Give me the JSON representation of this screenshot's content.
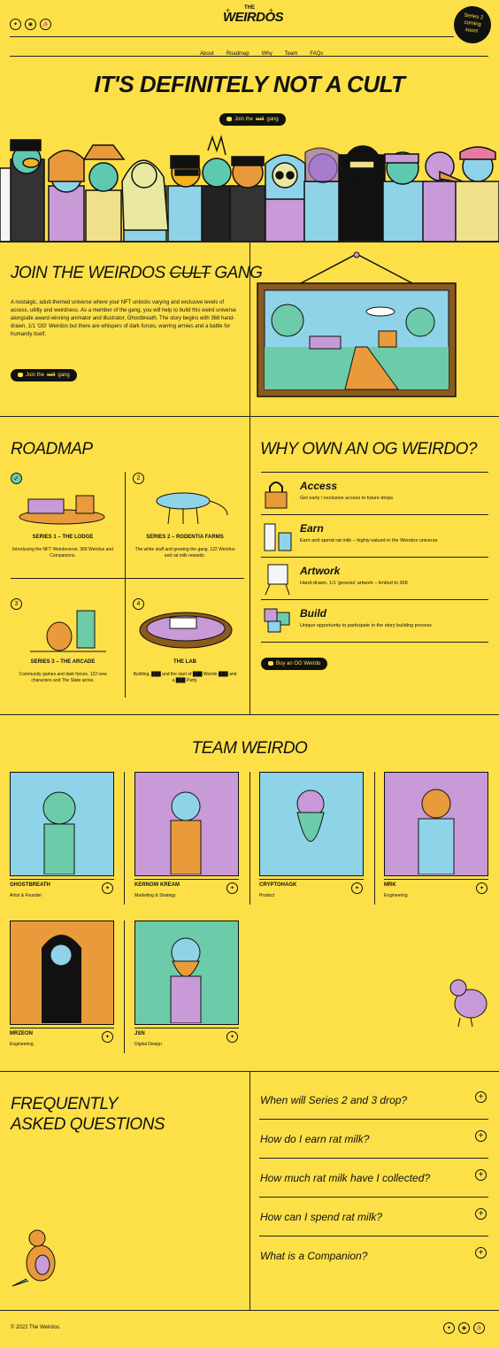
{
  "brand": {
    "logo_top": "THE",
    "logo_main": "WEIRDOS"
  },
  "badge": {
    "line1": "Series 2",
    "line2": "coming",
    "line3": "soon!"
  },
  "nav": [
    "About",
    "Roadmap",
    "Why",
    "Team",
    "FAQs"
  ],
  "hero": {
    "title": "IT'S DEFINITELY NOT A CULT",
    "cta_prefix": "Join the ",
    "cta_strike": "cult",
    "cta_suffix": " gang"
  },
  "about": {
    "title_prefix": "JOIN THE WEIRDOS ",
    "title_strike": "CULT",
    "title_suffix": " GANG",
    "body": "A nostalgic, adult-themed universe where your NFT unlocks varying and exclusive levels of access, utility and weirdness. As a member of the gang, you will help to build this weird universe alongside award-winning animator and illustrator, Ghostbreath. The story begins with 368 hand-drawn, 1/1 'OG' Weirdos but there are whispers of dark forces, warring armies and a battle for humanity itself.",
    "cta_prefix": "Join the ",
    "cta_strike": "cult",
    "cta_suffix": " gang"
  },
  "roadmap": {
    "title": "ROADMAP",
    "items": [
      {
        "num": "✓",
        "title": "SERIES 1 – THE LODGE",
        "desc": "Introducing the NFT Weirdoverse. 368 Weirdos and Companions."
      },
      {
        "num": "2",
        "title": "SERIES 2 – RODENTIA FARMS",
        "desc": "The white stuff and growing the gang. 122 Weirdos and rat milk rewards."
      },
      {
        "num": "3",
        "title": "SERIES 3 – THE ARCADE",
        "desc": "Community games and dark forces. 122 new characters and The State arrive."
      },
      {
        "num": "4",
        "title": "THE LAB",
        "desc": "Building, ███ and the start of ███ Weirdo ███ and a ███ Party."
      }
    ]
  },
  "why": {
    "title": "WHY OWN AN OG WEIRDO?",
    "items": [
      {
        "title": "Access",
        "desc": "Get early / exclusive access to future drops"
      },
      {
        "title": "Earn",
        "desc": "Earn and spend rat milk – highly-valued in the Weirdos universe"
      },
      {
        "title": "Artwork",
        "desc": "Hand-drawn, 1/1 'genesis' artwork – limited to 368"
      },
      {
        "title": "Build",
        "desc": "Unique opportunity to participate in the story building process"
      }
    ],
    "cta": "Buy an OG Weirdo"
  },
  "team": {
    "title": "TEAM WEIRDO",
    "members": [
      {
        "name": "GHOSTBREATH",
        "role": "Artist & Founder",
        "bg": "#8FD3E8"
      },
      {
        "name": "KERNOW KREAM",
        "role": "Marketing & Strategy",
        "bg": "#C89AD8"
      },
      {
        "name": "CRYPTOHAGK",
        "role": "Product",
        "bg": "#8FD3E8"
      },
      {
        "name": "MRK",
        "role": "Engineering",
        "bg": "#C89AD8"
      },
      {
        "name": "MRZEON",
        "role": "Engineering",
        "bg": "#E99A3A"
      },
      {
        "name": "JSN",
        "role": "Digital Design",
        "bg": "#6CCBA8"
      }
    ]
  },
  "faq": {
    "title_line1": "FREQUENTLY",
    "title_line2": "ASKED QUESTIONS",
    "questions": [
      "When will Series 2 and 3 drop?",
      "How do I earn rat milk?",
      "How much rat milk have I collected?",
      "How can I spend rat milk?",
      "What is a Companion?"
    ]
  },
  "footer": {
    "copyright": "© 2022 The Weirdos."
  },
  "icons": [
    "twitter-icon",
    "discord-icon",
    "boat-icon"
  ]
}
